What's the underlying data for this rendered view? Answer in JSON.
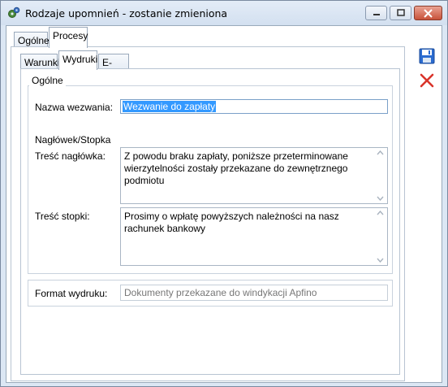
{
  "window": {
    "title": "Rodzaje upomnień - zostanie zmieniona"
  },
  "tabs_main": [
    {
      "label": "Ogólne"
    },
    {
      "label": "Procesy",
      "active": true
    }
  ],
  "tabs_sub": [
    {
      "label": "Warunki"
    },
    {
      "label": "Wydruki",
      "active": true
    },
    {
      "label": "E-mail"
    }
  ],
  "general": {
    "legend": "Ogólne",
    "name_label": "Nazwa wezwania:",
    "name_value": "Wezwanie do zapłaty",
    "section_header": "Nagłówek/Stopka",
    "header_label": "Treść nagłówka:",
    "header_text": "Z powodu braku zapłaty, poniższe przeterminowane wierzytelności zostały przekazane do zewnętrznego podmiotu",
    "footer_label": "Treść stopki:",
    "footer_text": "Prosimy o wpłatę powyższych należności na nasz rachunek bankowy"
  },
  "format": {
    "label": "Format wydruku:",
    "value": "Dokumenty przekazane do windykacji Apfino"
  },
  "colors": {
    "accent": "#2a6bd0",
    "close_red": "#d9342b",
    "selection": "#3399ff"
  }
}
